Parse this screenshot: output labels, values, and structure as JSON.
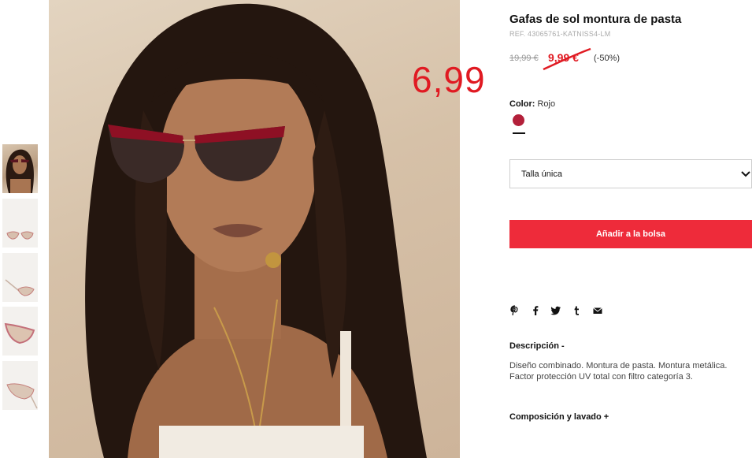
{
  "product": {
    "title": "Gafas de sol montura de pasta",
    "ref": "REF. 43065761-KATNISS4-LM",
    "old_price": "19,99 €",
    "sale_price": "9,99 €",
    "discount": "(-50%)",
    "overlay_price": "6,99"
  },
  "color": {
    "label": "Color:",
    "value": "Rojo",
    "swatch_color": "#b3203a"
  },
  "size": {
    "selected": "Talla única"
  },
  "cart": {
    "add_label": "Añadir a la bolsa",
    "button_color": "#ee2b3a"
  },
  "share": [
    "pinterest-icon",
    "facebook-icon",
    "twitter-icon",
    "tumblr-icon",
    "email-icon"
  ],
  "description": {
    "heading": "Descripción -",
    "text": "Diseño combinado. Montura de pasta. Montura metálica. Factor protección UV total con filtro categoría 3."
  },
  "composition": {
    "heading": "Composición y lavado +"
  },
  "gallery": {
    "thumbnails": [
      "model",
      "front",
      "side",
      "angle",
      "top"
    ]
  }
}
